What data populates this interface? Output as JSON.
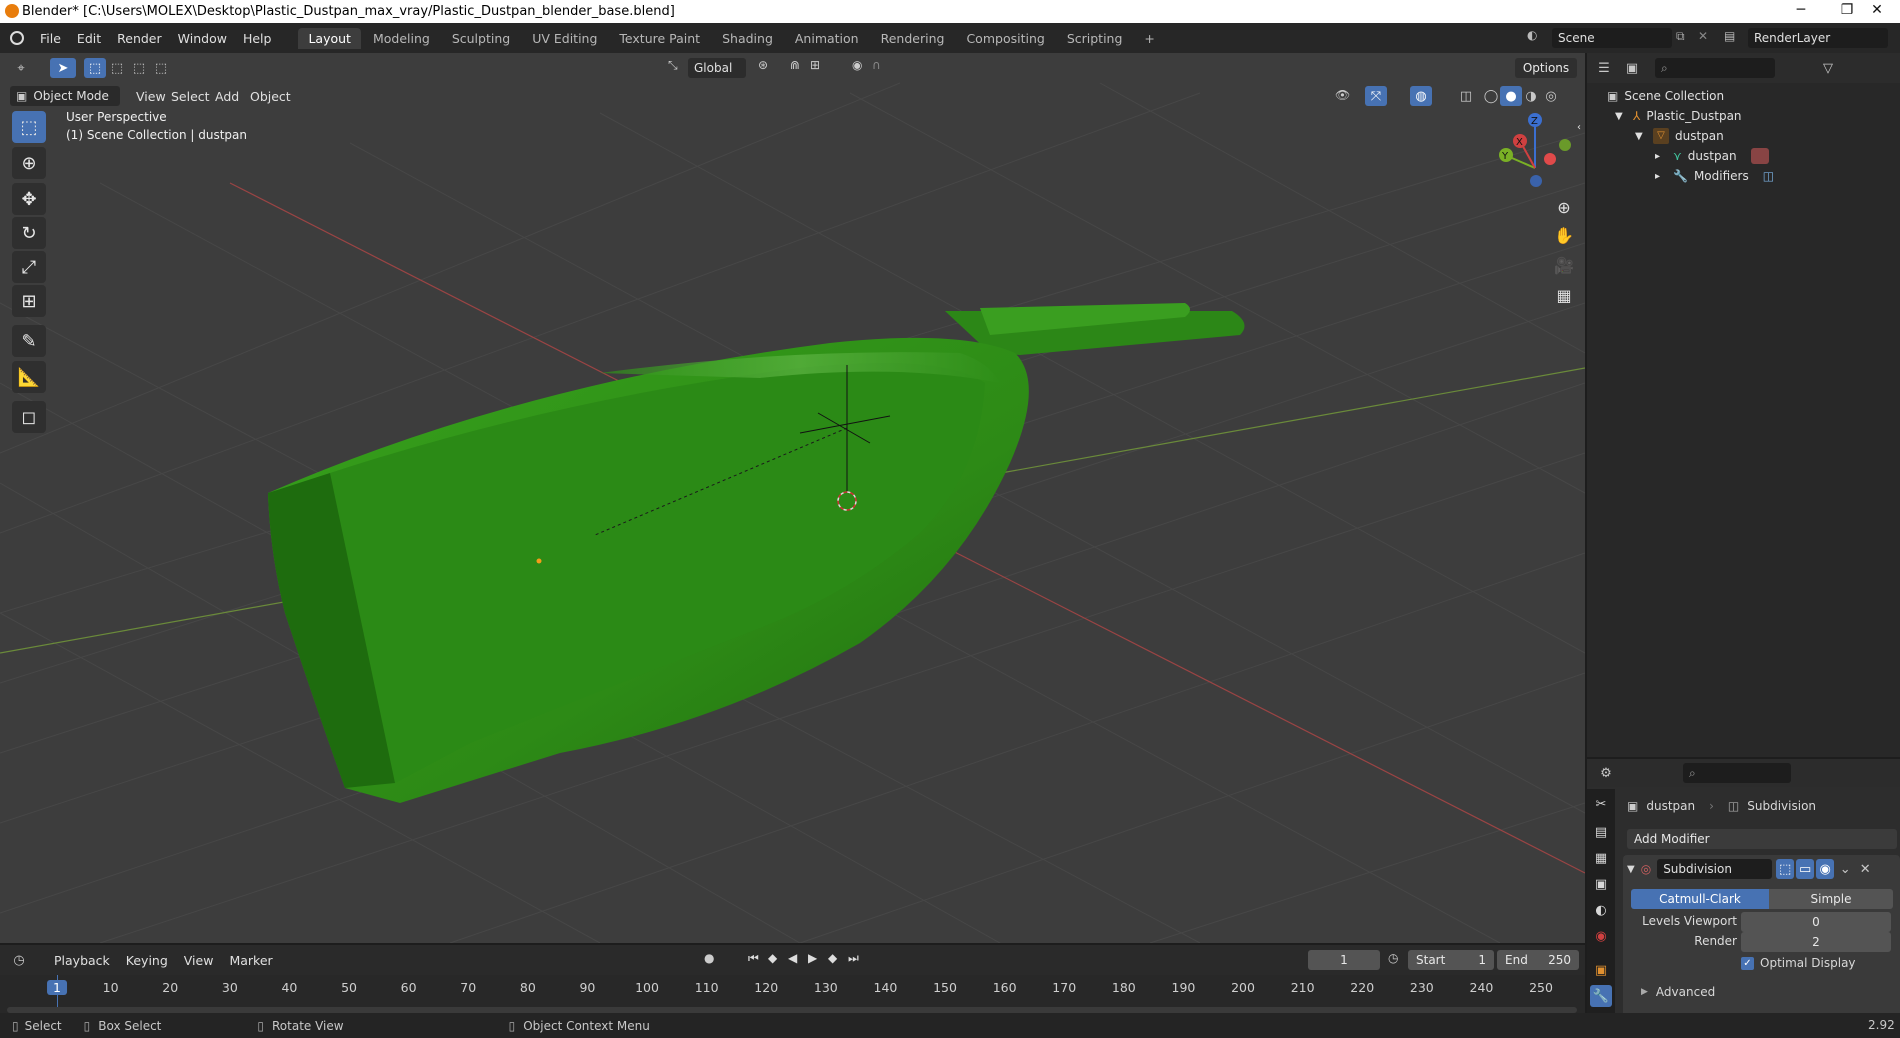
{
  "window": {
    "title": "Blender* [C:\\Users\\MOLEX\\Desktop\\Plastic_Dustpan_max_vray/Plastic_Dustpan_blender_base.blend]",
    "minimize": "─",
    "restore": "❐",
    "close": "✕"
  },
  "menus": [
    "File",
    "Edit",
    "Render",
    "Window",
    "Help"
  ],
  "workspaces": [
    "Layout",
    "Modeling",
    "Sculpting",
    "UV Editing",
    "Texture Paint",
    "Shading",
    "Animation",
    "Rendering",
    "Compositing",
    "Scripting"
  ],
  "active_workspace": "Layout",
  "add_workspace": "+",
  "scene": {
    "name": "Scene",
    "render_layer": "RenderLayer"
  },
  "tool_header": {
    "orientation": "Global",
    "options": "Options"
  },
  "viewport_header": {
    "mode": "Object Mode",
    "view": "View",
    "select": "Select",
    "add": "Add",
    "object": "Object"
  },
  "viewport": {
    "perspective": "User Perspective",
    "collection": "(1) Scene Collection | dustpan",
    "accent_color": "#4772b3",
    "object_color": "#2f8a18"
  },
  "gizmo": {
    "z": "Z",
    "y": "Y",
    "x": "X"
  },
  "outliner": {
    "root": "Scene Collection",
    "items": [
      {
        "label": "Plastic_Dustpan",
        "arrow": "▼"
      },
      {
        "label": "dustpan",
        "arrow": "▼"
      },
      {
        "label": "dustpan",
        "arrow": "▸"
      },
      {
        "label": "Modifiers",
        "arrow": "▸"
      }
    ]
  },
  "properties": {
    "object": "dustpan",
    "modifier_breadcrumb": "Subdivision",
    "add_modifier": "Add Modifier",
    "modifier_name": "Subdivision",
    "types": [
      "Catmull-Clark",
      "Simple"
    ],
    "active_type": "Catmull-Clark",
    "levels_viewport_label": "Levels Viewport",
    "levels_viewport": "0",
    "render_label": "Render",
    "render": "2",
    "optimal_display": "Optimal Display",
    "advanced": "Advanced"
  },
  "timeline": {
    "menus": [
      "Playback",
      "Keying",
      "View",
      "Marker"
    ],
    "current_frame": "1",
    "start_label": "Start",
    "start": "1",
    "end_label": "End",
    "end": "250",
    "ticks": [
      "1",
      "10",
      "20",
      "30",
      "40",
      "50",
      "60",
      "70",
      "80",
      "90",
      "100",
      "110",
      "120",
      "130",
      "140",
      "150",
      "160",
      "170",
      "180",
      "190",
      "200",
      "210",
      "220",
      "230",
      "240",
      "250"
    ]
  },
  "status": {
    "select": "Select",
    "box_select": "Box Select",
    "rotate_view": "Rotate View",
    "context_menu": "Object Context Menu",
    "version": "2.92"
  }
}
